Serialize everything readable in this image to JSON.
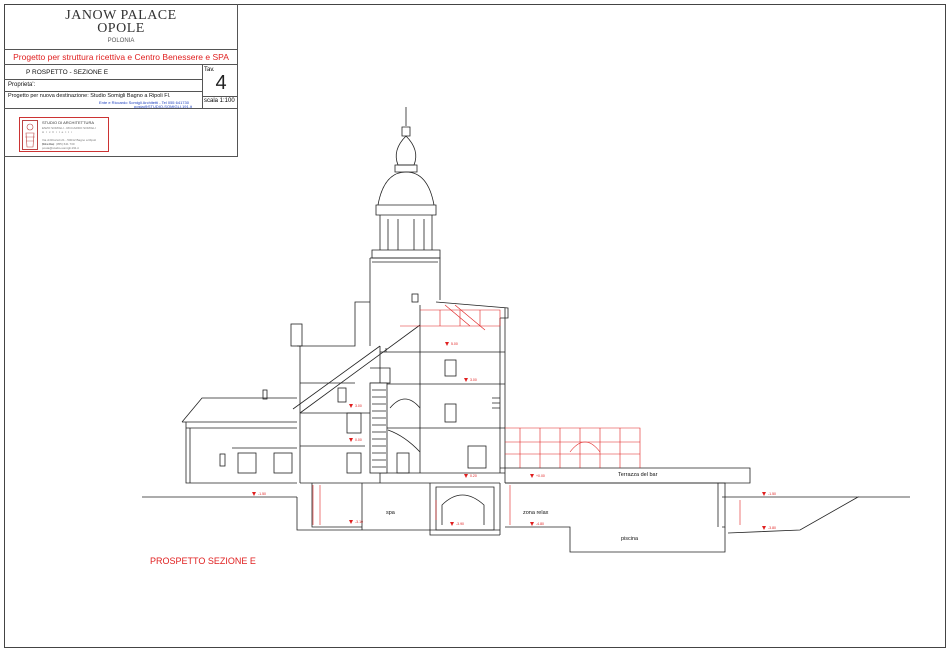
{
  "title_block": {
    "line1": "JANOW PALACE",
    "line2": "OPOLE",
    "line3": "POLONIA",
    "project": "Progetto per struttura ricettiva e Centro Benessere e SPA",
    "drawing": "P ROSPETTO - SEZIONE  E",
    "tav_label": "Tav.",
    "tav_number": "4",
    "owner": "Proprieta':",
    "destination": "Progetto per nuova destinazione: Studio Somigli  Bagno a Ripoli Fl.",
    "architects": "Ente e Riccardo Somigli Architetti - Tel 055 641730",
    "email": "posta@STUDIO-SOMIGLI.191.it",
    "scale": "scala 1:100"
  },
  "logo": {
    "name": "STUDIO DI ARCHITETTURA",
    "sub1": "ENZO SOMIGLI - RICCARDO SOMIGLI",
    "sub2": "Architetti",
    "addr": "Via di Ritortoli 21 - 50012 Bagno a Ripoli (Firenze)",
    "tel": "Tel e Fax: (055) 641 730",
    "mail": "posta@studio-somigli.191.it"
  },
  "labels": {
    "spa": "spa",
    "zona_relax": "zona relax",
    "piscina": "piscina",
    "terrazza": "Terrazza del bar",
    "caption": "PROSPETTO SEZIONE  E"
  },
  "levels": [
    "5.00",
    "3.00",
    "3.00",
    "0.00",
    "0.20",
    "-1.50",
    "-3.10",
    "-3.90",
    "-4.80",
    "-1.50",
    "-3.80",
    "7.00",
    "+0.00",
    "+0.10"
  ],
  "colors": {
    "line": "#222222",
    "red": "#e02020",
    "blue": "#1c3fbf"
  }
}
